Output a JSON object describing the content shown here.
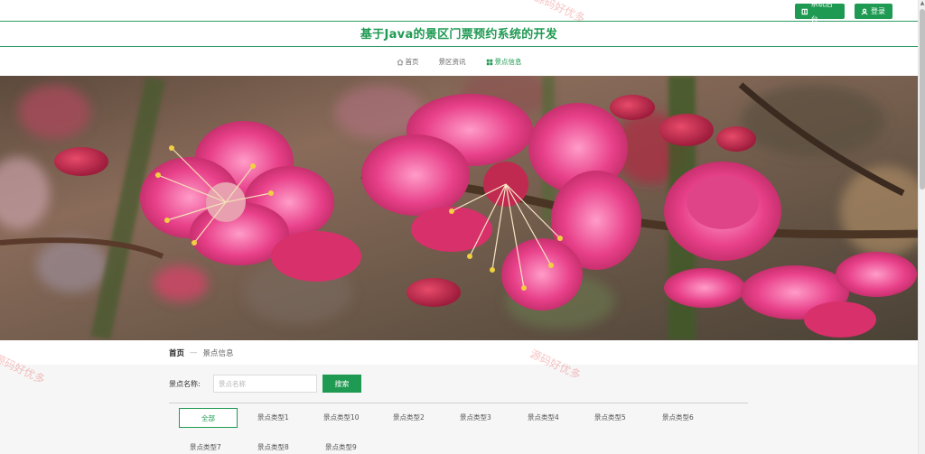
{
  "header": {
    "admin_button": "系统后台",
    "login_button": "登录",
    "site_title": "基于Java的景区门票预约系统的开发"
  },
  "nav": {
    "items": [
      {
        "label": "首页"
      },
      {
        "label": "景区资讯"
      },
      {
        "label": "景点信息"
      }
    ],
    "active_index": 2
  },
  "breadcrumb": {
    "home": "首页",
    "separator": "—",
    "current": "景点信息"
  },
  "search": {
    "label": "景点名称:",
    "placeholder": "景点名称",
    "value": "",
    "button": "搜索"
  },
  "categories": {
    "items": [
      "全部",
      "景点类型1",
      "景点类型10",
      "景点类型2",
      "景点类型3",
      "景点类型4",
      "景点类型5",
      "景点类型6",
      "景点类型7",
      "景点类型8",
      "景点类型9"
    ],
    "active_index": 0
  },
  "watermarks": [
    "源码好优多",
    "源码好优多",
    "源码好优多"
  ],
  "colors": {
    "accent": "#1f9a52",
    "banner_blossom": "#e8408a"
  }
}
